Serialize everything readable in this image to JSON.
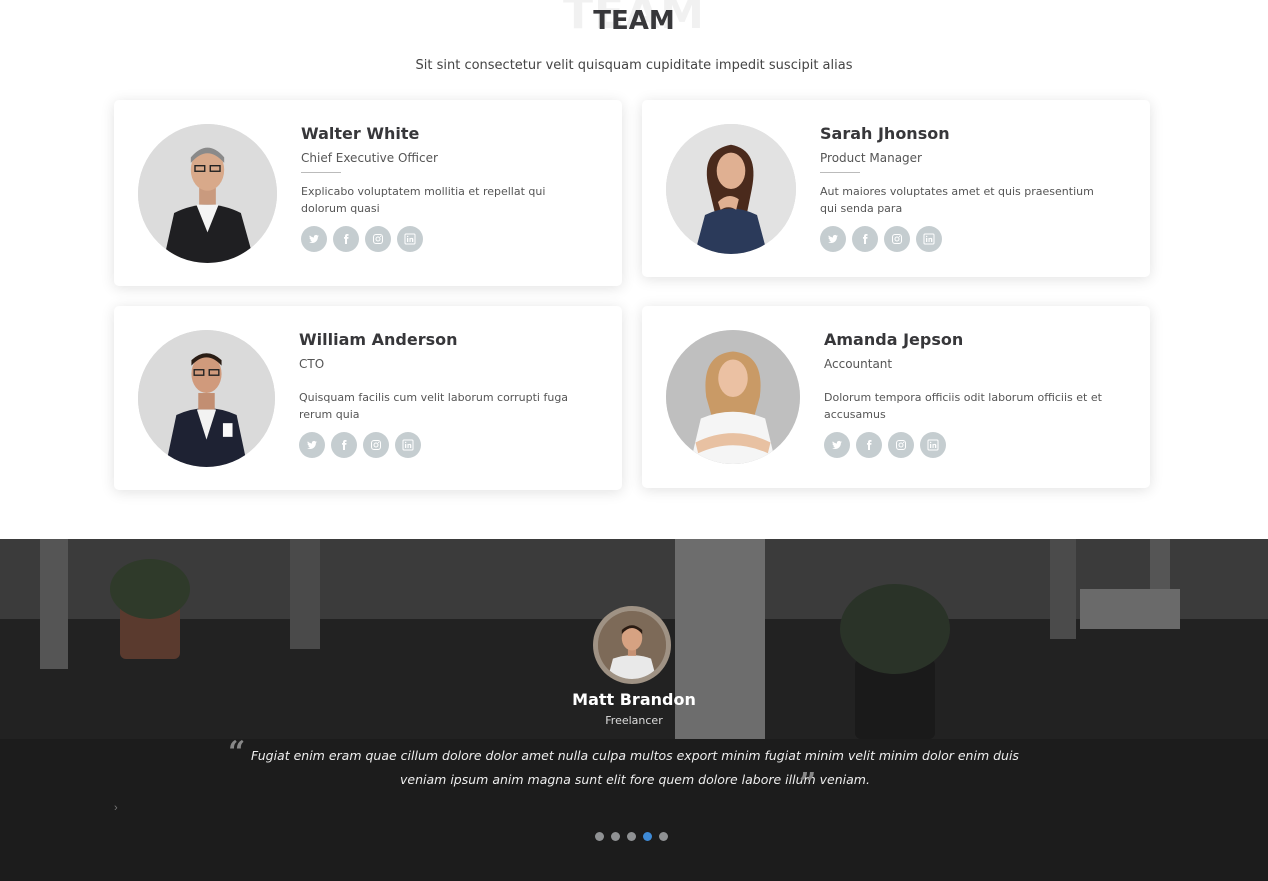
{
  "team": {
    "ghost_title": "TEAM",
    "title": "TEAM",
    "subtitle": "Sit sint consectetur velit quisquam cupiditate impedit suscipit alias",
    "members": [
      {
        "name": "Walter White",
        "role": "Chief Executive Officer",
        "desc": "Explicabo voluptatem mollitia et repellat qui dolorum quasi"
      },
      {
        "name": "Sarah Jhonson",
        "role": "Product Manager",
        "desc": "Aut maiores voluptates amet et quis praesentium qui senda para"
      },
      {
        "name": "William Anderson",
        "role": "CTO",
        "desc": "Quisquam facilis cum velit laborum corrupti fuga rerum quia"
      },
      {
        "name": "Amanda Jepson",
        "role": "Accountant",
        "desc": "Dolorum tempora officiis odit laborum officiis et et accusamus"
      }
    ],
    "social_icons": [
      "twitter-icon",
      "facebook-icon",
      "instagram-icon",
      "linkedin-icon"
    ]
  },
  "testimonial": {
    "name": "Matt Brandon",
    "role": "Freelancer",
    "quote": "Fugiat enim eram quae cillum dolore dolor amet nulla culpa multos export minim fugiat minim velit minim dolor enim duis veniam ipsum anim magna sunt elit fore quem dolore labore illum veniam.",
    "quote_open": "“",
    "quote_close": "”",
    "active_slide": 4,
    "slide_count": 5
  },
  "colors": {
    "accent": "#3e8ad6",
    "social_bg": "#c5cdd0",
    "heading": "#37373a"
  }
}
